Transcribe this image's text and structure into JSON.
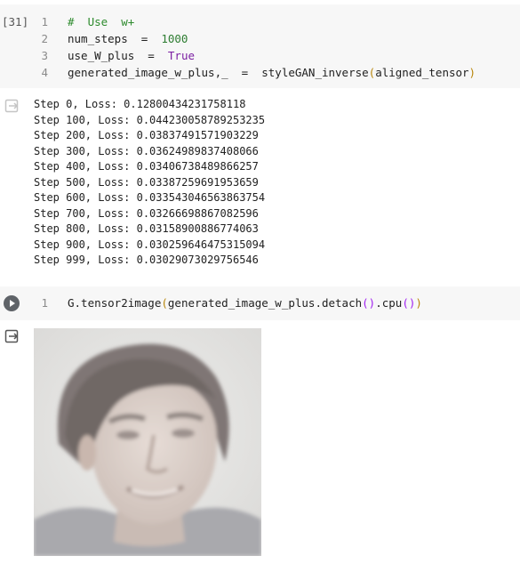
{
  "cell1": {
    "exec_count": "[31]",
    "lines": [
      {
        "num": "1",
        "parts": [
          {
            "t": "#  Use  w+",
            "c": "comment"
          }
        ]
      },
      {
        "num": "2",
        "parts": [
          {
            "t": "num_steps  =  ",
            "c": ""
          },
          {
            "t": "1000",
            "c": "num"
          }
        ]
      },
      {
        "num": "3",
        "parts": [
          {
            "t": "use_W_plus  =  ",
            "c": ""
          },
          {
            "t": "True",
            "c": "kw"
          }
        ]
      },
      {
        "num": "4",
        "parts": [
          {
            "t": "generated_image_w_plus,_  =  styleGAN_inverse",
            "c": ""
          },
          {
            "t": "(",
            "c": "paren"
          },
          {
            "t": "aligned_tensor",
            "c": ""
          },
          {
            "t": ")",
            "c": "paren"
          }
        ]
      }
    ]
  },
  "output1": {
    "lines": [
      "Step 0, Loss: 0.12800434231758118",
      "Step 100, Loss: 0.044230058789253235",
      "Step 200, Loss: 0.03837491571903229",
      "Step 300, Loss: 0.03624989837408066",
      "Step 400, Loss: 0.03406738489866257",
      "Step 500, Loss: 0.03387259691953659",
      "Step 600, Loss: 0.033543046563863754",
      "Step 700, Loss: 0.03266698867082596",
      "Step 800, Loss: 0.03158900886774063",
      "Step 900, Loss: 0.030259646475315094",
      "Step 999, Loss: 0.03029073029756546"
    ]
  },
  "cell2": {
    "lines": [
      {
        "num": "1",
        "parts": [
          {
            "t": "G.tensor2image",
            "c": ""
          },
          {
            "t": "(",
            "c": "paren"
          },
          {
            "t": "generated_image_w_plus.detach",
            "c": ""
          },
          {
            "t": "()",
            "c": "paren2"
          },
          {
            "t": ".cpu",
            "c": ""
          },
          {
            "t": "()",
            "c": "paren2"
          },
          {
            "t": ")",
            "c": "paren"
          }
        ]
      }
    ]
  },
  "icons": {
    "output_icon": "output-arrow-icon",
    "run_button": "play-icon"
  }
}
